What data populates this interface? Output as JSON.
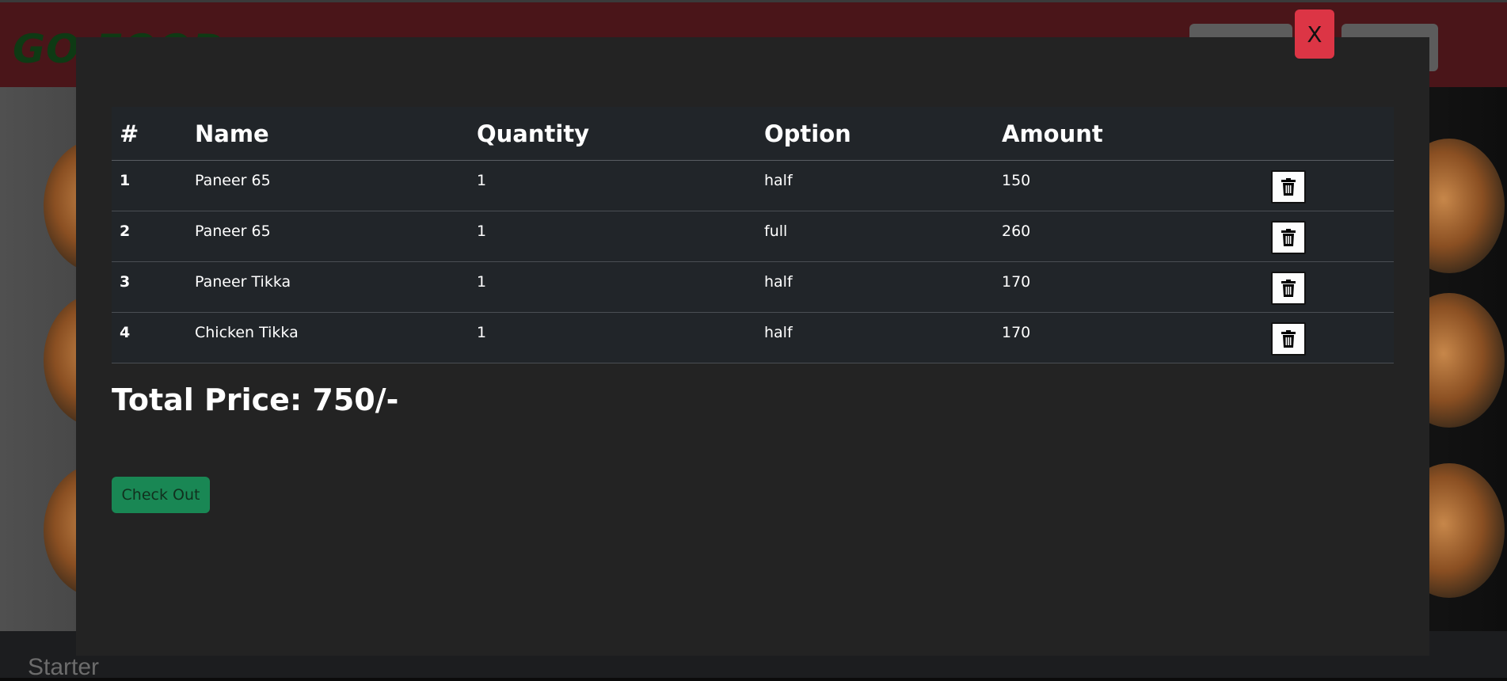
{
  "navbar": {
    "brand": "GO FOOD"
  },
  "background": {
    "section_title": "Starter"
  },
  "modal": {
    "close_label": "X",
    "table": {
      "headers": [
        "#",
        "Name",
        "Quantity",
        "Option",
        "Amount"
      ],
      "rows": [
        {
          "index": "1",
          "name": "Paneer 65",
          "quantity": "1",
          "option": "half",
          "amount": "150"
        },
        {
          "index": "2",
          "name": "Paneer 65",
          "quantity": "1",
          "option": "full",
          "amount": "260"
        },
        {
          "index": "3",
          "name": "Paneer Tikka",
          "quantity": "1",
          "option": "half",
          "amount": "170"
        },
        {
          "index": "4",
          "name": "Chicken Tikka",
          "quantity": "1",
          "option": "half",
          "amount": "170"
        }
      ],
      "delete_icon": "trash-icon"
    },
    "total_text": "Total Price: 750/-",
    "checkout_label": "Check Out"
  },
  "colors": {
    "navbar": "#4a1519",
    "modal_bg": "#232323",
    "table_bg": "#212529",
    "close_button": "#dc3545",
    "checkout_button": "#198754"
  }
}
